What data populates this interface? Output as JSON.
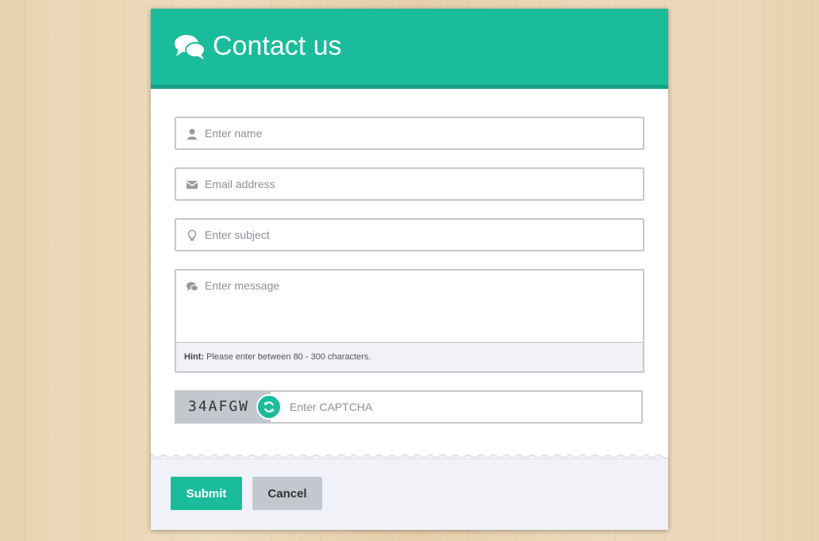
{
  "header": {
    "title": "Contact us",
    "icon": "chat-bubbles-icon"
  },
  "form": {
    "name": {
      "placeholder": "Enter name",
      "icon": "user-icon"
    },
    "email": {
      "placeholder": "Email address",
      "icon": "envelope-icon"
    },
    "subject": {
      "placeholder": "Enter subject",
      "icon": "lightbulb-icon"
    },
    "message": {
      "placeholder": "Enter message",
      "icon": "chat-icon",
      "hint_label": "Hint:",
      "hint_text": " Please enter between 80 - 300 characters."
    },
    "captcha": {
      "code": "34AFGW",
      "placeholder": "Enter CAPTCHA",
      "refresh_icon": "refresh-icon"
    }
  },
  "footer": {
    "submit_label": "Submit",
    "cancel_label": "Cancel"
  },
  "colors": {
    "accent": "#1bbc9b",
    "accent_dark": "#16a085",
    "footer_bg": "#f0f2f7",
    "button_grey": "#c3c8ce"
  }
}
